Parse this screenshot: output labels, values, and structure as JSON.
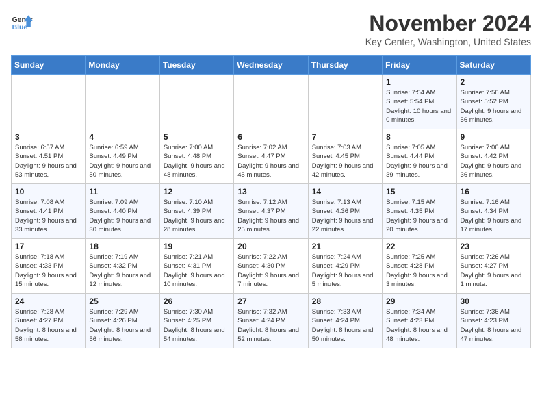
{
  "logo": {
    "line1": "General",
    "line2": "Blue"
  },
  "title": "November 2024",
  "location": "Key Center, Washington, United States",
  "days_of_week": [
    "Sunday",
    "Monday",
    "Tuesday",
    "Wednesday",
    "Thursday",
    "Friday",
    "Saturday"
  ],
  "weeks": [
    [
      {
        "day": "",
        "info": ""
      },
      {
        "day": "",
        "info": ""
      },
      {
        "day": "",
        "info": ""
      },
      {
        "day": "",
        "info": ""
      },
      {
        "day": "",
        "info": ""
      },
      {
        "day": "1",
        "info": "Sunrise: 7:54 AM\nSunset: 5:54 PM\nDaylight: 10 hours and 0 minutes."
      },
      {
        "day": "2",
        "info": "Sunrise: 7:56 AM\nSunset: 5:52 PM\nDaylight: 9 hours and 56 minutes."
      }
    ],
    [
      {
        "day": "3",
        "info": "Sunrise: 6:57 AM\nSunset: 4:51 PM\nDaylight: 9 hours and 53 minutes."
      },
      {
        "day": "4",
        "info": "Sunrise: 6:59 AM\nSunset: 4:49 PM\nDaylight: 9 hours and 50 minutes."
      },
      {
        "day": "5",
        "info": "Sunrise: 7:00 AM\nSunset: 4:48 PM\nDaylight: 9 hours and 48 minutes."
      },
      {
        "day": "6",
        "info": "Sunrise: 7:02 AM\nSunset: 4:47 PM\nDaylight: 9 hours and 45 minutes."
      },
      {
        "day": "7",
        "info": "Sunrise: 7:03 AM\nSunset: 4:45 PM\nDaylight: 9 hours and 42 minutes."
      },
      {
        "day": "8",
        "info": "Sunrise: 7:05 AM\nSunset: 4:44 PM\nDaylight: 9 hours and 39 minutes."
      },
      {
        "day": "9",
        "info": "Sunrise: 7:06 AM\nSunset: 4:42 PM\nDaylight: 9 hours and 36 minutes."
      }
    ],
    [
      {
        "day": "10",
        "info": "Sunrise: 7:08 AM\nSunset: 4:41 PM\nDaylight: 9 hours and 33 minutes."
      },
      {
        "day": "11",
        "info": "Sunrise: 7:09 AM\nSunset: 4:40 PM\nDaylight: 9 hours and 30 minutes."
      },
      {
        "day": "12",
        "info": "Sunrise: 7:10 AM\nSunset: 4:39 PM\nDaylight: 9 hours and 28 minutes."
      },
      {
        "day": "13",
        "info": "Sunrise: 7:12 AM\nSunset: 4:37 PM\nDaylight: 9 hours and 25 minutes."
      },
      {
        "day": "14",
        "info": "Sunrise: 7:13 AM\nSunset: 4:36 PM\nDaylight: 9 hours and 22 minutes."
      },
      {
        "day": "15",
        "info": "Sunrise: 7:15 AM\nSunset: 4:35 PM\nDaylight: 9 hours and 20 minutes."
      },
      {
        "day": "16",
        "info": "Sunrise: 7:16 AM\nSunset: 4:34 PM\nDaylight: 9 hours and 17 minutes."
      }
    ],
    [
      {
        "day": "17",
        "info": "Sunrise: 7:18 AM\nSunset: 4:33 PM\nDaylight: 9 hours and 15 minutes."
      },
      {
        "day": "18",
        "info": "Sunrise: 7:19 AM\nSunset: 4:32 PM\nDaylight: 9 hours and 12 minutes."
      },
      {
        "day": "19",
        "info": "Sunrise: 7:21 AM\nSunset: 4:31 PM\nDaylight: 9 hours and 10 minutes."
      },
      {
        "day": "20",
        "info": "Sunrise: 7:22 AM\nSunset: 4:30 PM\nDaylight: 9 hours and 7 minutes."
      },
      {
        "day": "21",
        "info": "Sunrise: 7:24 AM\nSunset: 4:29 PM\nDaylight: 9 hours and 5 minutes."
      },
      {
        "day": "22",
        "info": "Sunrise: 7:25 AM\nSunset: 4:28 PM\nDaylight: 9 hours and 3 minutes."
      },
      {
        "day": "23",
        "info": "Sunrise: 7:26 AM\nSunset: 4:27 PM\nDaylight: 9 hours and 1 minute."
      }
    ],
    [
      {
        "day": "24",
        "info": "Sunrise: 7:28 AM\nSunset: 4:27 PM\nDaylight: 8 hours and 58 minutes."
      },
      {
        "day": "25",
        "info": "Sunrise: 7:29 AM\nSunset: 4:26 PM\nDaylight: 8 hours and 56 minutes."
      },
      {
        "day": "26",
        "info": "Sunrise: 7:30 AM\nSunset: 4:25 PM\nDaylight: 8 hours and 54 minutes."
      },
      {
        "day": "27",
        "info": "Sunrise: 7:32 AM\nSunset: 4:24 PM\nDaylight: 8 hours and 52 minutes."
      },
      {
        "day": "28",
        "info": "Sunrise: 7:33 AM\nSunset: 4:24 PM\nDaylight: 8 hours and 50 minutes."
      },
      {
        "day": "29",
        "info": "Sunrise: 7:34 AM\nSunset: 4:23 PM\nDaylight: 8 hours and 48 minutes."
      },
      {
        "day": "30",
        "info": "Sunrise: 7:36 AM\nSunset: 4:23 PM\nDaylight: 8 hours and 47 minutes."
      }
    ]
  ]
}
